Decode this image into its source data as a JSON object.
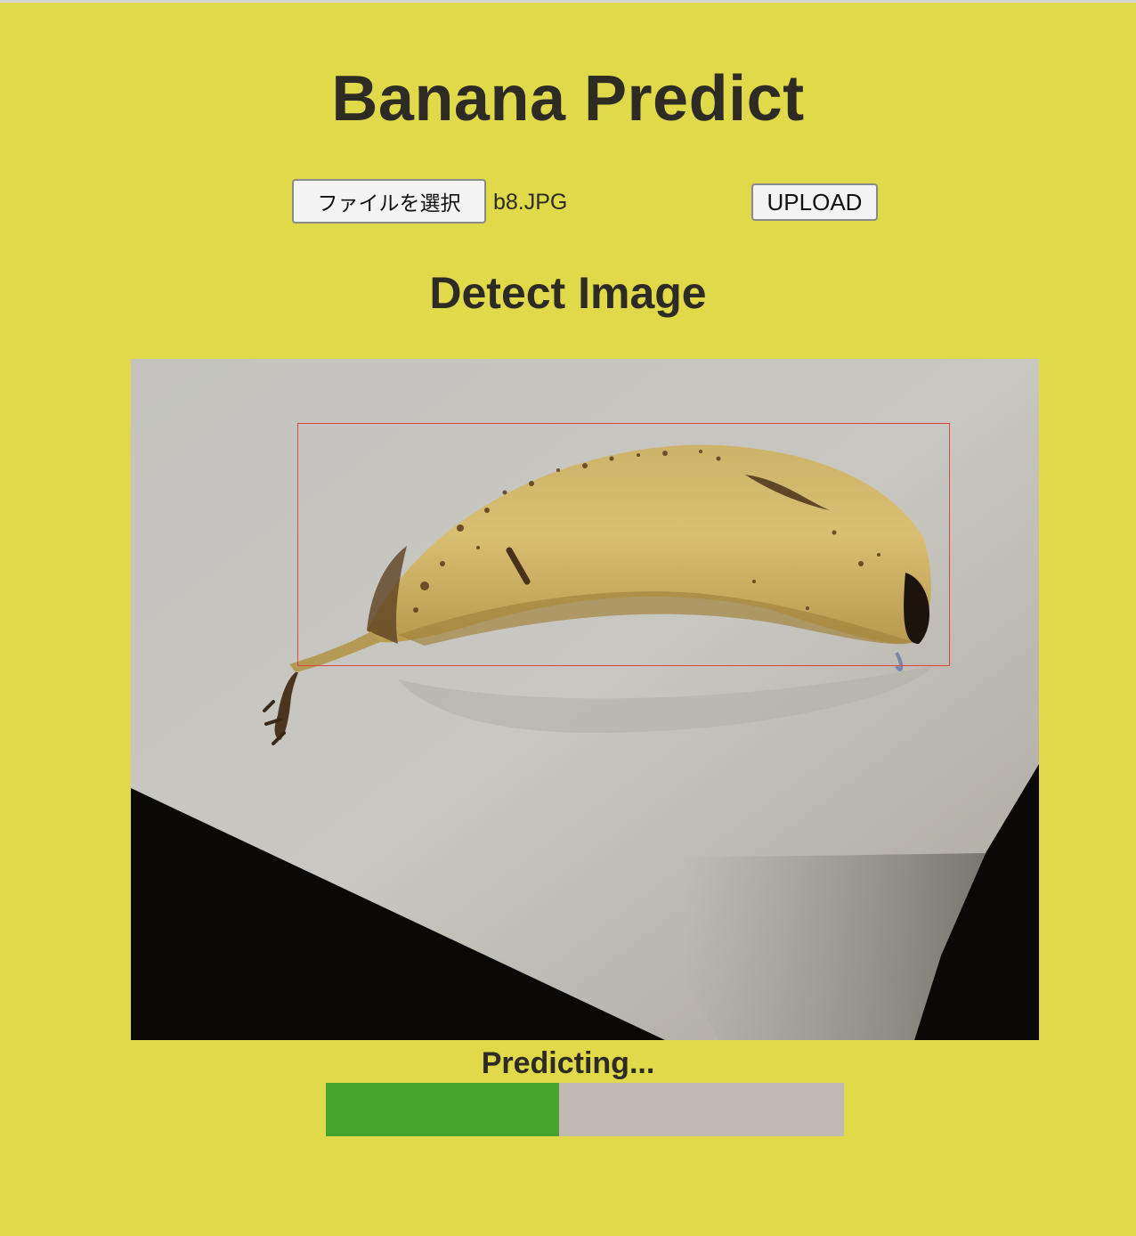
{
  "page": {
    "title": "Banana Predict",
    "background_color": "#e0d94a"
  },
  "upload_form": {
    "file_button_label": "ファイルを選択",
    "selected_file_name": "b8.JPG",
    "upload_button_label": "UPLOAD"
  },
  "detection": {
    "heading": "Detect Image",
    "box_color": "#e0443c"
  },
  "prediction": {
    "status_text": "Predicting...",
    "progress_fraction": 0.45,
    "progress_color": "#47a230",
    "track_color": "#c2b9b5"
  }
}
